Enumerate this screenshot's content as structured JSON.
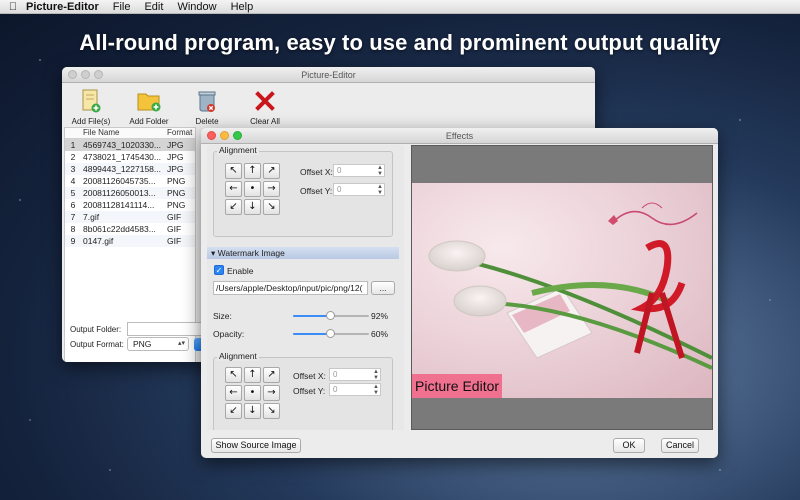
{
  "menubar": {
    "app_name": "Picture-Editor",
    "items": [
      "File",
      "Edit",
      "Window",
      "Help"
    ]
  },
  "headline": "All-round program, easy to use and prominent output quality",
  "main_window": {
    "title": "Picture-Editor",
    "toolbar": {
      "add_files": "Add File(s)",
      "add_folder": "Add Folder",
      "delete": "Delete",
      "clear_all": "Clear All"
    },
    "table": {
      "col_name": "File Name",
      "col_format": "Format",
      "rows": [
        {
          "n": "1",
          "name": "4569743_1020330...",
          "format": "JPG"
        },
        {
          "n": "2",
          "name": "4738021_1745430...",
          "format": "JPG"
        },
        {
          "n": "3",
          "name": "4899443_1227158...",
          "format": "JPG"
        },
        {
          "n": "4",
          "name": "20081126045735...",
          "format": "PNG"
        },
        {
          "n": "5",
          "name": "20081126050013...",
          "format": "PNG"
        },
        {
          "n": "6",
          "name": "20081128141114...",
          "format": "PNG"
        },
        {
          "n": "7",
          "name": "7.gif",
          "format": "GIF"
        },
        {
          "n": "8",
          "name": "8b061c22dd4583...",
          "format": "GIF"
        },
        {
          "n": "9",
          "name": "0147.gif",
          "format": "GIF"
        }
      ]
    },
    "output_folder_label": "Output Folder:",
    "output_format_label": "Output Format:",
    "output_format_value": "PNG"
  },
  "effects_window": {
    "title": "Effects",
    "alignment_label": "Alignment",
    "offset_x_label": "Offset X:",
    "offset_y_label": "Offset Y:",
    "offset_x_value": "0",
    "offset_y_value": "0",
    "arrows": [
      "↖",
      "↑",
      "↗",
      "←",
      "•",
      "→",
      "↙",
      "↓",
      "↘"
    ],
    "watermark_section": "Watermark Image",
    "enable_label": "Enable",
    "enable_checked": true,
    "path_value": "/Users/apple/Desktop/input/pic/png/12(",
    "browse_label": "...",
    "size_label": "Size:",
    "size_value": "92%",
    "size_level": 0.5,
    "opacity_label": "Opacity:",
    "opacity_value": "60%",
    "opacity_level": 0.5,
    "alignment2_label": "Alignment",
    "offset_x2_value": "0",
    "offset_y2_value": "0",
    "watermark_text": "Picture Editor",
    "show_source_label": "Show Source Image",
    "ok_label": "OK",
    "cancel_label": "Cancel"
  }
}
